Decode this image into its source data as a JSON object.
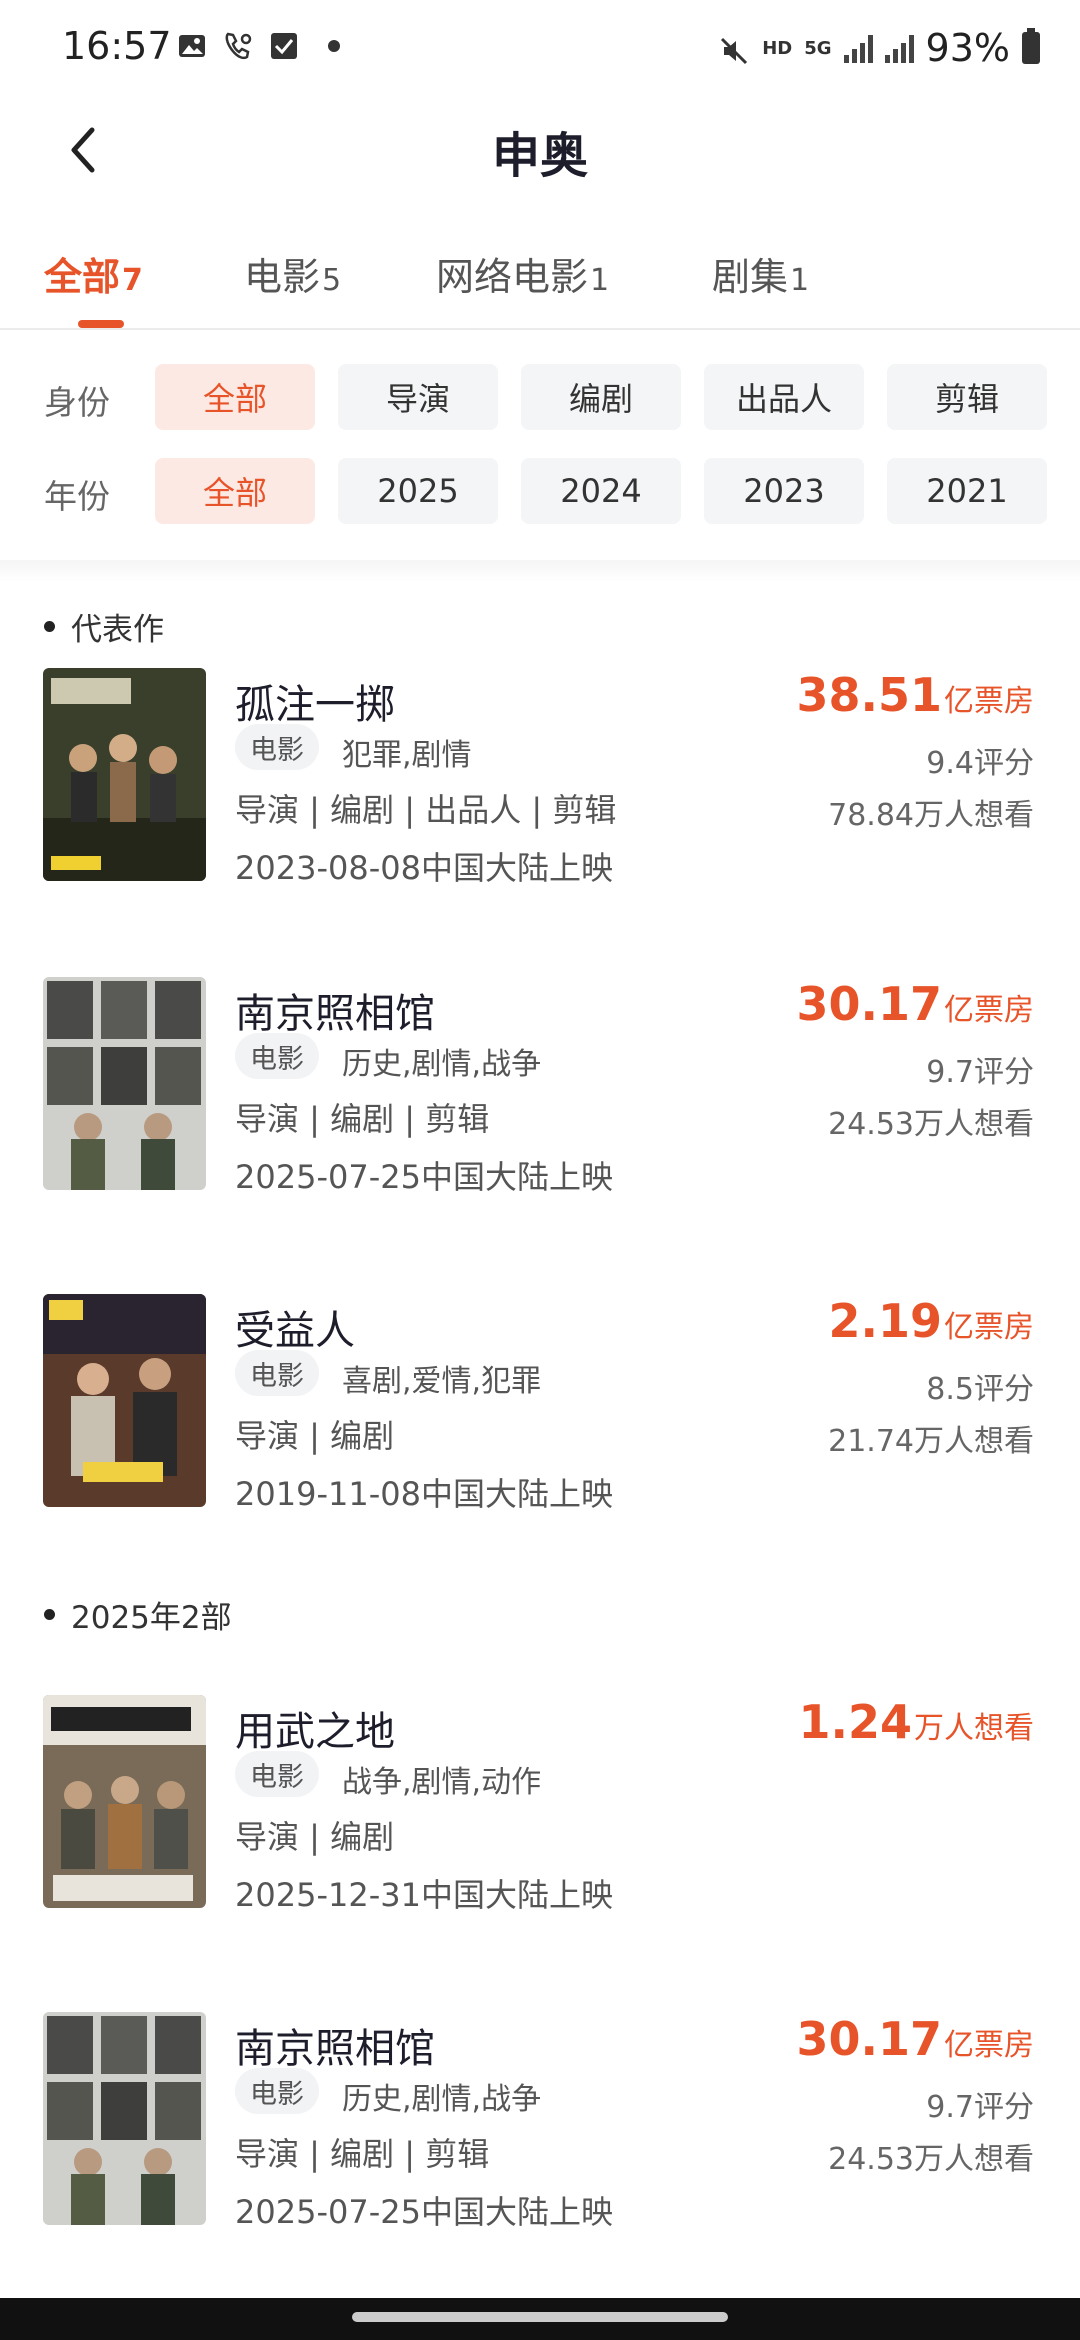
{
  "status_bar": {
    "time": "16:57",
    "hd": "HD",
    "net": "5G",
    "battery": "93%"
  },
  "header": {
    "title": "申奥"
  },
  "tabs": [
    {
      "label": "全部",
      "count": "7"
    },
    {
      "label": "电影",
      "count": "5"
    },
    {
      "label": "网络电影",
      "count": "1"
    },
    {
      "label": "剧集",
      "count": "1"
    }
  ],
  "filters": {
    "identity": {
      "label": "身份",
      "options": [
        "全部",
        "导演",
        "编剧",
        "出品人",
        "剪辑"
      ]
    },
    "year": {
      "label": "年份",
      "options": [
        "全部",
        "2025",
        "2024",
        "2023",
        "2021"
      ]
    }
  },
  "sections": [
    {
      "title": "代表作",
      "movies": [
        {
          "title": "孤注一掷",
          "type": "电影",
          "genres": "犯罪,剧情",
          "roles": "导演 | 编剧 | 出品人 | 剪辑",
          "release": "2023-08-08中国大陆上映",
          "stat_value": "38.51",
          "stat_unit": "亿票房",
          "score": "9.4评分",
          "want": "78.84万人想看",
          "poster_color": "#3a3f2c"
        },
        {
          "title": "南京照相馆",
          "type": "电影",
          "genres": "历史,剧情,战争",
          "roles": "导演 | 编剧 | 剪辑",
          "release": "2025-07-25中国大陆上映",
          "stat_value": "30.17",
          "stat_unit": "亿票房",
          "score": "9.7评分",
          "want": "24.53万人想看",
          "poster_color": "#6e6e6a"
        },
        {
          "title": "受益人",
          "type": "电影",
          "genres": "喜剧,爱情,犯罪",
          "roles": "导演 | 编剧",
          "release": "2019-11-08中国大陆上映",
          "stat_value": "2.19",
          "stat_unit": "亿票房",
          "score": "8.5评分",
          "want": "21.74万人想看",
          "poster_color": "#5a3a2a"
        }
      ]
    },
    {
      "title": "2025年2部",
      "movies": [
        {
          "title": "用武之地",
          "type": "电影",
          "genres": "战争,剧情,动作",
          "roles": "导演 | 编剧",
          "release": "2025-12-31中国大陆上映",
          "stat_value": "1.24",
          "stat_unit": "万人想看",
          "score": "",
          "want": "",
          "poster_color": "#7a6a58"
        },
        {
          "title": "南京照相馆",
          "type": "电影",
          "genres": "历史,剧情,战争",
          "roles": "导演 | 编剧 | 剪辑",
          "release": "2025-07-25中国大陆上映",
          "stat_value": "30.17",
          "stat_unit": "亿票房",
          "score": "9.7评分",
          "want": "24.53万人想看",
          "poster_color": "#6e6e6a"
        }
      ]
    }
  ],
  "colors": {
    "accent": "#e8542a",
    "chip_active_bg": "#fde9e3"
  }
}
